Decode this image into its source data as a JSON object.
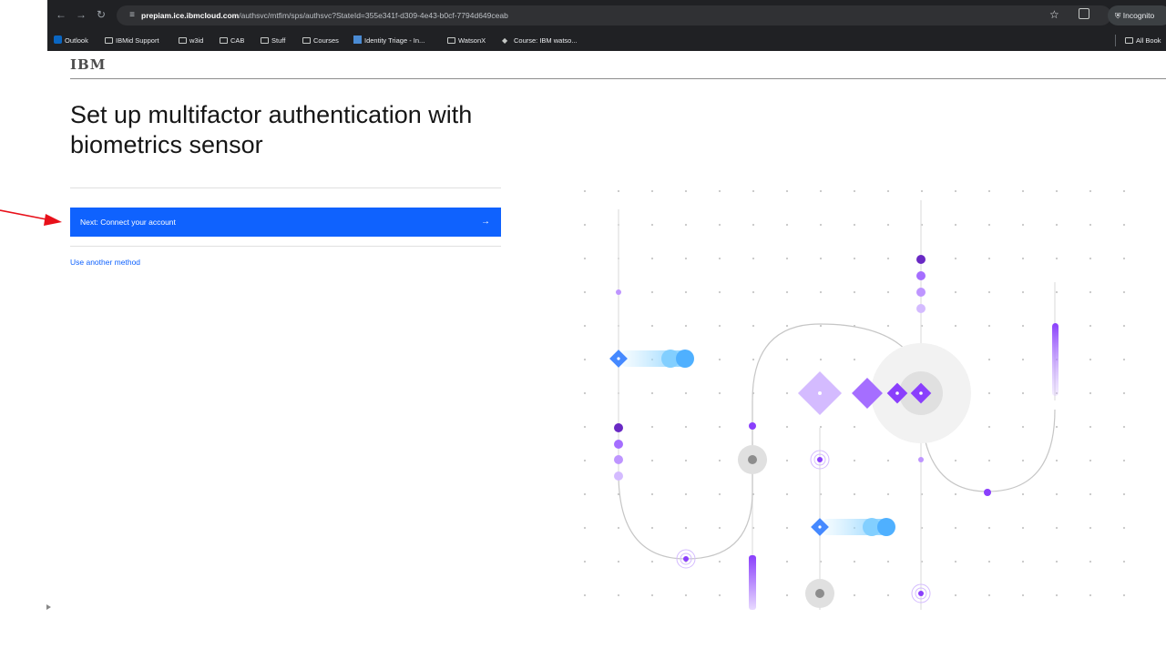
{
  "browser": {
    "url_host": "prepiam.ice.ibmcloud.com",
    "url_path": "/authsvc/mtfim/sps/authsvc?StateId=355e341f-d309-4e43-b0cf-7794d649ceab",
    "incognito_label": "Incognito",
    "bookmarks": [
      "Outlook",
      "IBMid Support",
      "w3id",
      "CAB",
      "Stuff",
      "Courses",
      "Identity Triage - In...",
      "WatsonX",
      "Course: IBM watso..."
    ],
    "all_bookmarks": "All Book"
  },
  "page": {
    "logo": "IBM",
    "title": "Set up multifactor authentication with biometrics sensor",
    "primary_button": "Next: Connect your account",
    "primary_arrow": "→",
    "alt_link": "Use another method"
  },
  "icons": {
    "back": "arrow-left-icon",
    "forward": "arrow-right-icon",
    "reload": "reload-icon",
    "site_info": "tune-icon",
    "bookmark": "star-icon",
    "extensions": "extensions-icon",
    "incognito": "incognito-icon",
    "folder": "folder-icon",
    "annotation": "red-arrow-icon"
  },
  "colors": {
    "accent": "#0f62fe",
    "annotation": "#e8101a",
    "chrome_bg": "#202124",
    "illustration_purple": "#8a3ffc",
    "illustration_blue": "#4589ff"
  }
}
